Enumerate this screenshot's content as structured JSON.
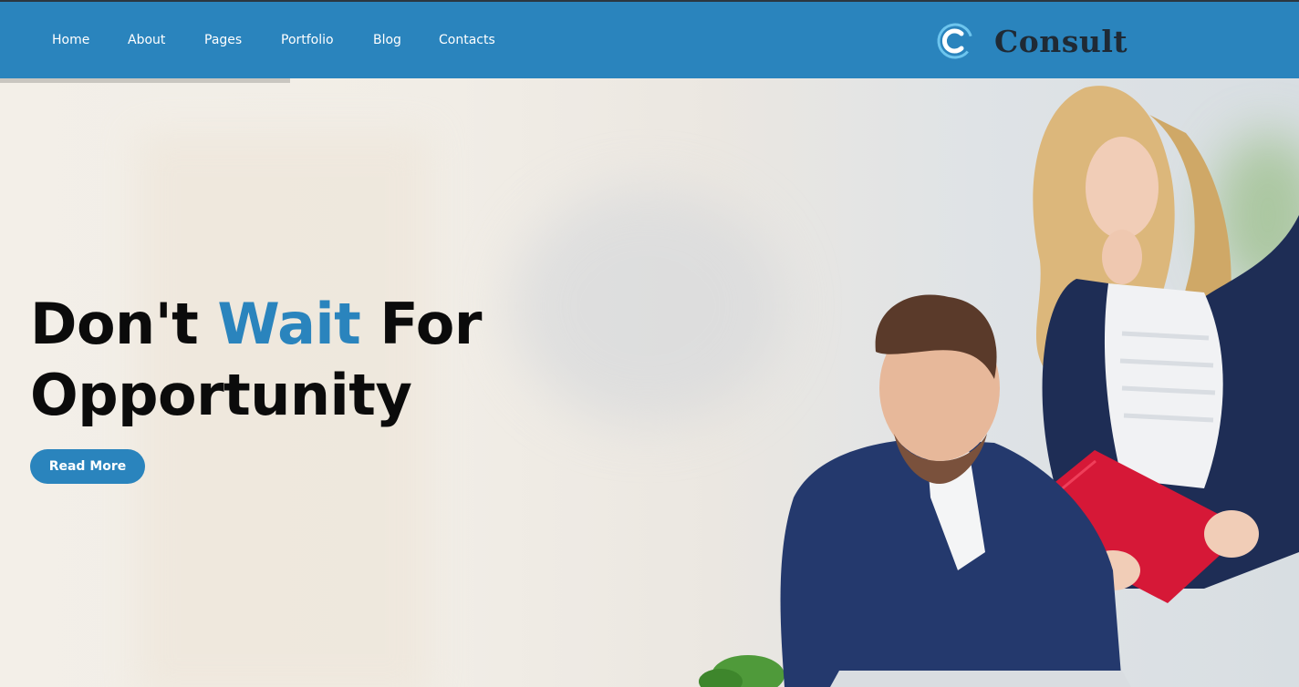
{
  "nav": {
    "items": [
      {
        "label": "Home"
      },
      {
        "label": "About"
      },
      {
        "label": "Pages"
      },
      {
        "label": "Portfolio"
      },
      {
        "label": "Blog"
      },
      {
        "label": "Contacts"
      }
    ]
  },
  "brand": {
    "name": "Consult",
    "icon": "c-logo-icon"
  },
  "hero": {
    "headline_part1": "Don't ",
    "headline_accent": "Wait",
    "headline_part2": " For",
    "headline_line2": "Opportunity",
    "cta_label": "Read More"
  },
  "colors": {
    "primary": "#2a84bd",
    "heading": "#0b0b0b",
    "logo_text": "#1f2a35"
  }
}
